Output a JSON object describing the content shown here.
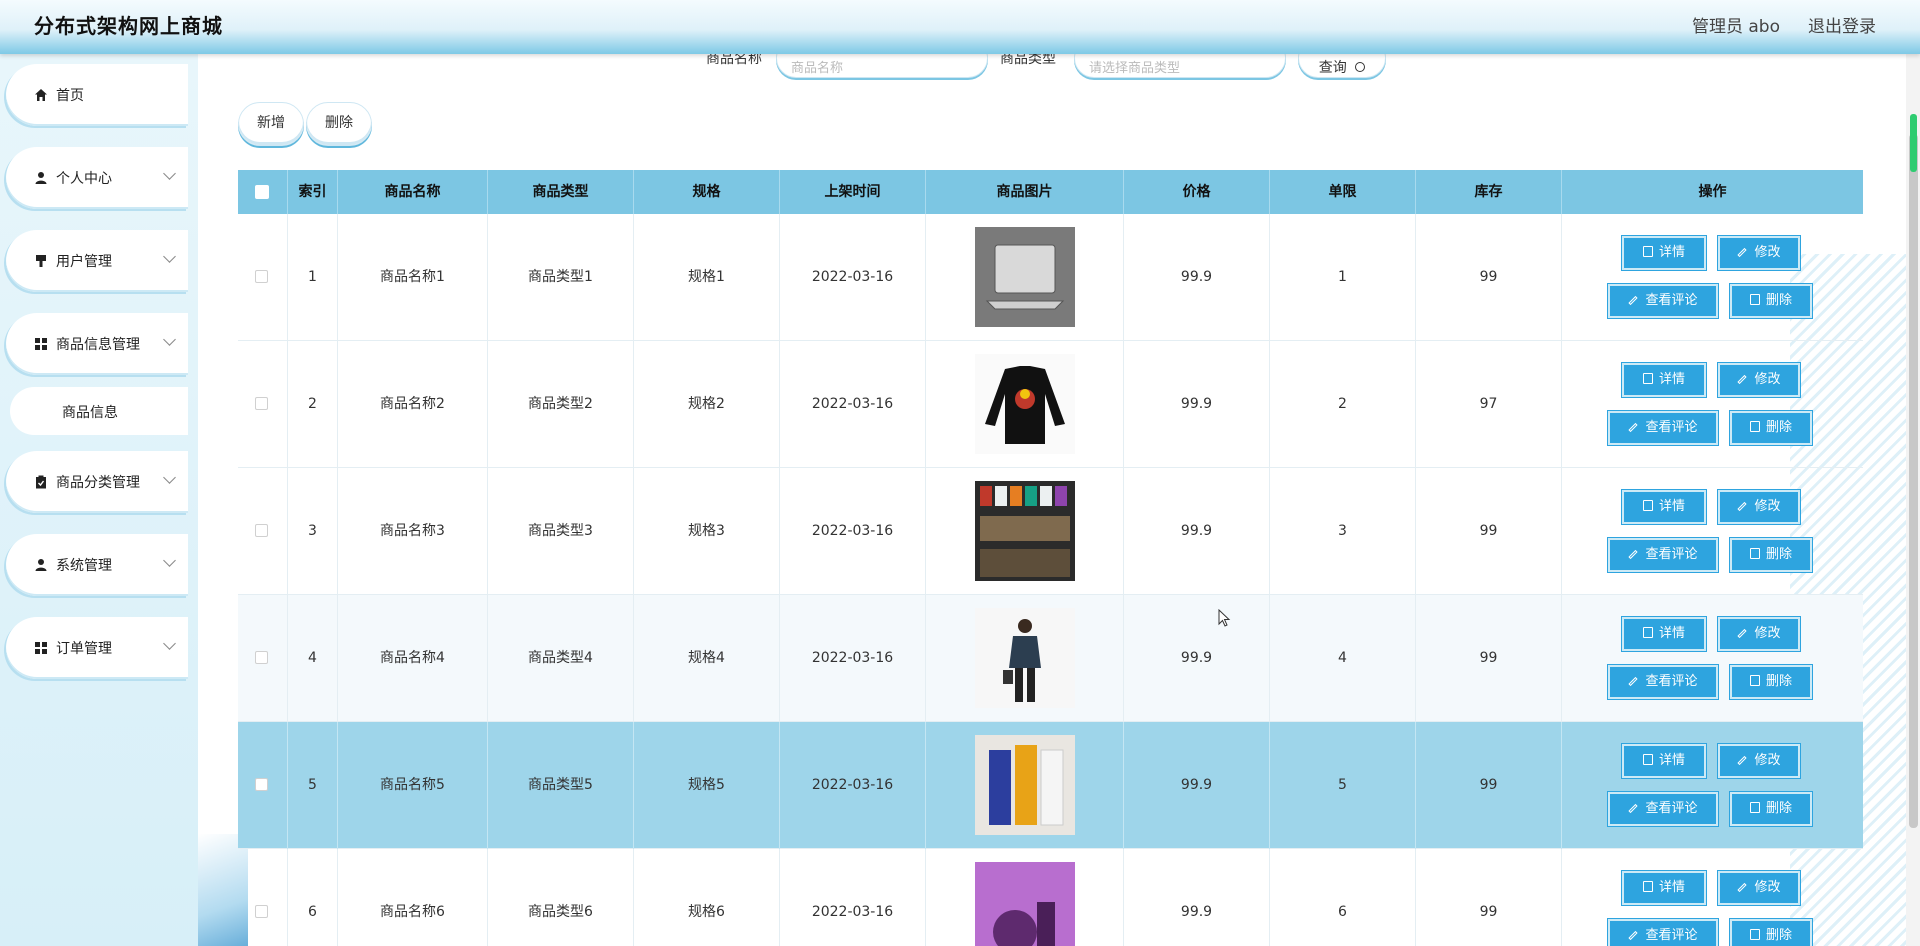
{
  "app": {
    "title": "分布式架构网上商城",
    "user_label": "管理员 abo",
    "logout_label": "退出登录"
  },
  "sidebar": {
    "items": [
      {
        "label": "首页",
        "icon": "home-icon"
      },
      {
        "label": "个人中心",
        "icon": "person-icon"
      },
      {
        "label": "用户管理",
        "icon": "user-manage-icon"
      },
      {
        "label": "商品信息管理",
        "icon": "grid-icon"
      },
      {
        "label": "商品分类管理",
        "icon": "clipboard-icon"
      },
      {
        "label": "系统管理",
        "icon": "person-icon"
      },
      {
        "label": "订单管理",
        "icon": "grid-icon"
      }
    ],
    "subitem": "商品信息"
  },
  "search": {
    "name_label": "商品名称",
    "name_placeholder": "商品名称",
    "type_label": "商品类型",
    "type_placeholder": "请选择商品类型",
    "query_label": "查询"
  },
  "toolbar": {
    "add_label": "新增",
    "delete_label": "删除"
  },
  "table": {
    "headers": [
      "索引",
      "商品名称",
      "商品类型",
      "规格",
      "上架时间",
      "商品图片",
      "价格",
      "单限",
      "库存",
      "操作"
    ],
    "actions": {
      "detail": "详情",
      "edit": "修改",
      "review": "查看评论",
      "delete": "删除"
    },
    "rows": [
      {
        "idx": "1",
        "name": "商品名称1",
        "type": "商品类型1",
        "spec": "规格1",
        "date": "2022-03-16",
        "price": "99.9",
        "limit": "1",
        "stock": "99"
      },
      {
        "idx": "2",
        "name": "商品名称2",
        "type": "商品类型2",
        "spec": "规格2",
        "date": "2022-03-16",
        "price": "99.9",
        "limit": "2",
        "stock": "97"
      },
      {
        "idx": "3",
        "name": "商品名称3",
        "type": "商品类型3",
        "spec": "规格3",
        "date": "2022-03-16",
        "price": "99.9",
        "limit": "3",
        "stock": "99"
      },
      {
        "idx": "4",
        "name": "商品名称4",
        "type": "商品类型4",
        "spec": "规格4",
        "date": "2022-03-16",
        "price": "99.9",
        "limit": "4",
        "stock": "99"
      },
      {
        "idx": "5",
        "name": "商品名称5",
        "type": "商品类型5",
        "spec": "规格5",
        "date": "2022-03-16",
        "price": "99.9",
        "limit": "5",
        "stock": "99"
      },
      {
        "idx": "6",
        "name": "商品名称6",
        "type": "商品类型6",
        "spec": "规格6",
        "date": "2022-03-16",
        "price": "99.9",
        "limit": "6",
        "stock": "99"
      }
    ]
  },
  "colors": {
    "accent": "#2ea4df",
    "header_row": "#7cc6e3",
    "selected_row": "#9ed5ea"
  }
}
